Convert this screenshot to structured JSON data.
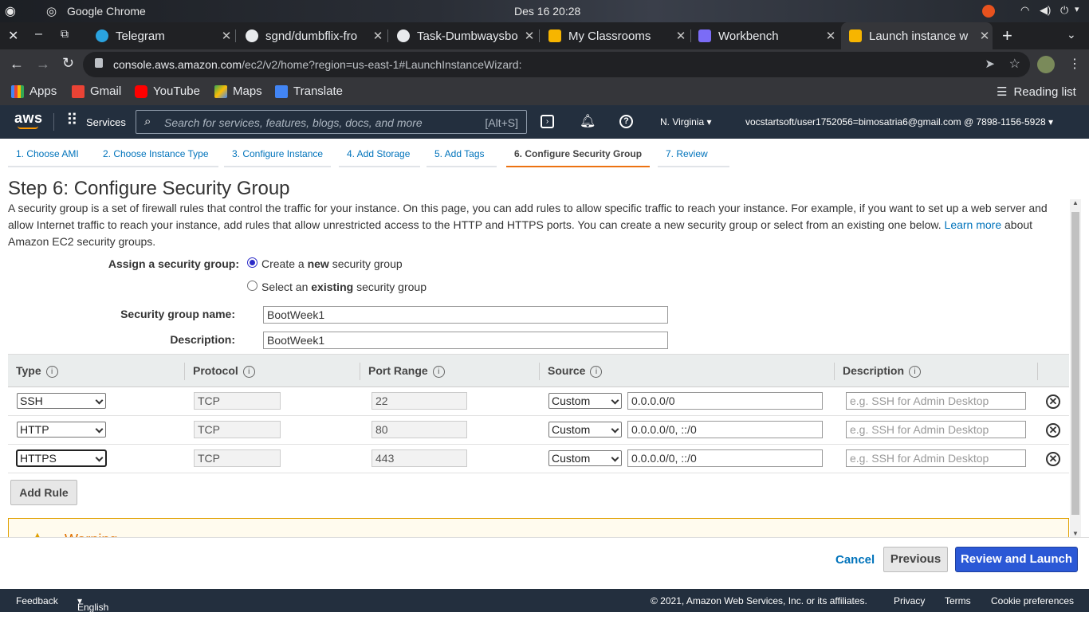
{
  "os": {
    "app": "Google Chrome",
    "datetime": "Des 16  20:28"
  },
  "tabs": [
    {
      "title": "Telegram",
      "color": "#2aa3df"
    },
    {
      "title": "sgnd/dumbflix-fro",
      "color": "#e8eaed"
    },
    {
      "title": "Task-Dumbwaysbo",
      "color": "#e8eaed"
    },
    {
      "title": "My Classrooms",
      "color": "#f7b500"
    },
    {
      "title": "Workbench",
      "color": "#7b6cf6"
    },
    {
      "title": "Launch instance w",
      "color": "#f7b500"
    }
  ],
  "address": {
    "domain": "console.aws.amazon.com",
    "path": "/ec2/v2/home?region=us-east-1#LaunchInstanceWizard:"
  },
  "bookmarks": [
    {
      "label": "Apps",
      "color": "#4285f4"
    },
    {
      "label": "Gmail",
      "color": "#ea4335"
    },
    {
      "label": "YouTube",
      "color": "#ff0000"
    },
    {
      "label": "Maps",
      "color": "#34a853"
    },
    {
      "label": "Translate",
      "color": "#4285f4"
    }
  ],
  "reading_list": "Reading list",
  "aws": {
    "logo": "aws",
    "services": "Services",
    "search_placeholder": "Search for services, features, blogs, docs, and more",
    "search_shortcut": "[Alt+S]",
    "region": "N. Virginia",
    "account": "vocstartsoft/user1752056=bimosatria6@gmail.com @ 7898-1156-5928"
  },
  "wizard_tabs": [
    "1. Choose AMI",
    "2. Choose Instance Type",
    "3. Configure Instance",
    "4. Add Storage",
    "5. Add Tags",
    "6. Configure Security Group",
    "7. Review"
  ],
  "heading": "Step 6: Configure Security Group",
  "intro": {
    "text": "A security group is a set of firewall rules that control the traffic for your instance. On this page, you can add rules to allow specific traffic to reach your instance. For example, if you want to set up a web server and allow Internet traffic to reach your instance, add rules that allow unrestricted access to the HTTP and HTTPS ports. You can create a new security group or select from an existing one below.",
    "link": "Learn more",
    "after": "about Amazon EC2 security groups."
  },
  "assign": {
    "label": "Assign a security group:",
    "opt1_pre": "Create a",
    "opt1_bold": "new",
    "opt1_post": "security group",
    "opt2_pre": "Select an",
    "opt2_bold": "existing",
    "opt2_post": "security group"
  },
  "sg_name": {
    "label": "Security group name:",
    "value": "BootWeek1"
  },
  "sg_desc": {
    "label": "Description:",
    "value": "BootWeek1"
  },
  "table": {
    "headers": [
      "Type",
      "Protocol",
      "Port Range",
      "Source",
      "Description"
    ],
    "rows": [
      {
        "type": "SSH",
        "protocol": "TCP",
        "port": "22",
        "source_mode": "Custom",
        "source": "0.0.0.0/0",
        "desc_placeholder": "e.g. SSH for Admin Desktop"
      },
      {
        "type": "HTTP",
        "protocol": "TCP",
        "port": "80",
        "source_mode": "Custom",
        "source": "0.0.0.0/0, ::/0",
        "desc_placeholder": "e.g. SSH for Admin Desktop"
      },
      {
        "type": "HTTPS",
        "protocol": "TCP",
        "port": "443",
        "source_mode": "Custom",
        "source": "0.0.0.0/0, ::/0",
        "desc_placeholder": "e.g. SSH for Admin Desktop"
      }
    ]
  },
  "add_rule": "Add Rule",
  "warning_title": "Warning",
  "buttons": {
    "cancel": "Cancel",
    "previous": "Previous",
    "review": "Review and Launch"
  },
  "footer": {
    "feedback": "Feedback",
    "language": "English (US)",
    "copyright": "© 2021, Amazon Web Services, Inc. or its affiliates.",
    "privacy": "Privacy",
    "terms": "Terms",
    "cookies": "Cookie preferences"
  }
}
